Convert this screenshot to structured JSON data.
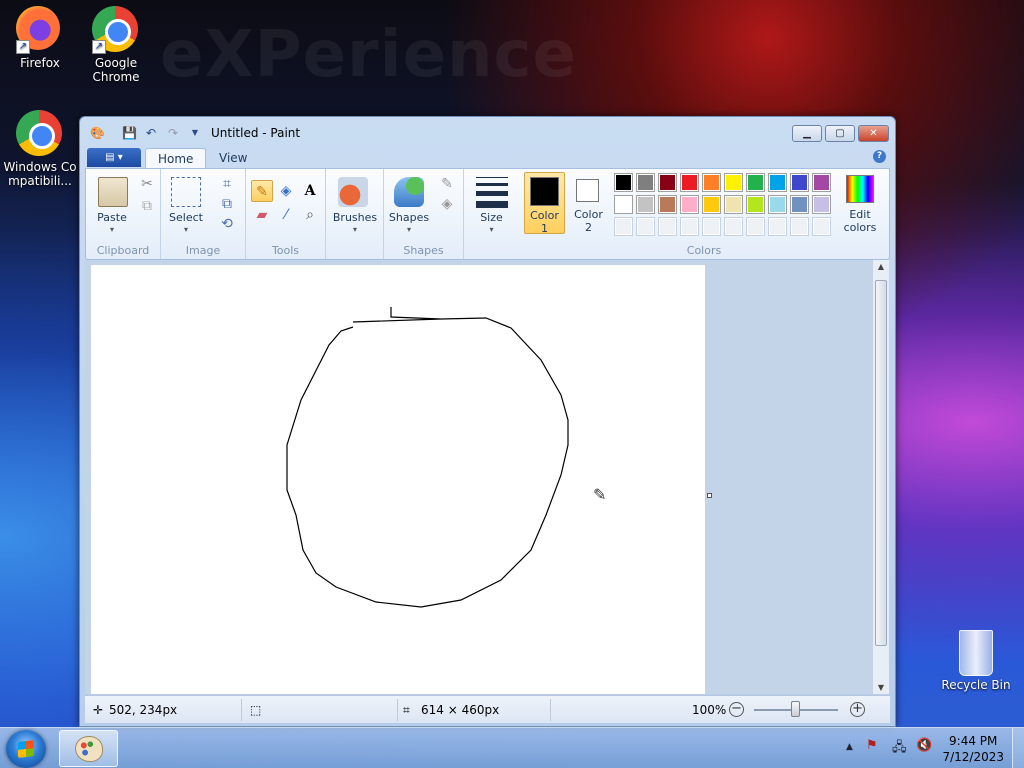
{
  "desktop": {
    "watermark": "eXPerience",
    "icons": [
      {
        "label": "Firefox"
      },
      {
        "label": "Google Chrome"
      },
      {
        "label": "Windows Compatibili..."
      },
      {
        "label": "Recycle Bin"
      }
    ]
  },
  "window": {
    "title": "Untitled - Paint",
    "tabs": [
      "Home",
      "View"
    ],
    "help": "?",
    "controls": {
      "minimize": "▁",
      "maximize": "▢",
      "close": "✕"
    }
  },
  "ribbon": {
    "groups": {
      "clipboard": "Clipboard",
      "image": "Image",
      "tools": "Tools",
      "shapes": "Shapes",
      "colors": "Colors"
    },
    "buttons": {
      "paste": "Paste",
      "select": "Select",
      "brushes": "Brushes",
      "shapes": "Shapes",
      "size": "Size",
      "color1_line1": "Color",
      "color1_line2": "1",
      "color2_line1": "Color",
      "color2_line2": "2",
      "edit_colors_line1": "Edit",
      "edit_colors_line2": "colors"
    },
    "palette_row1": [
      "#000000",
      "#7f7f7f",
      "#880015",
      "#ed1c24",
      "#ff7f27",
      "#fff200",
      "#22b14c",
      "#00a2e8",
      "#3f48cc",
      "#a349a4"
    ],
    "palette_row2": [
      "#ffffff",
      "#c3c3c3",
      "#b97a57",
      "#ffaec9",
      "#ffc90e",
      "#efe4b0",
      "#b5e61d",
      "#99d9ea",
      "#7092be",
      "#c8bfe7"
    ],
    "color1": "#000000",
    "color2": "#ffffff"
  },
  "status": {
    "cursor_pos": "502, 234px",
    "canvas_size": "614 × 460px",
    "zoom": "100%"
  },
  "taskbar": {
    "time": "9:44 PM",
    "date": "7/12/2023"
  }
}
